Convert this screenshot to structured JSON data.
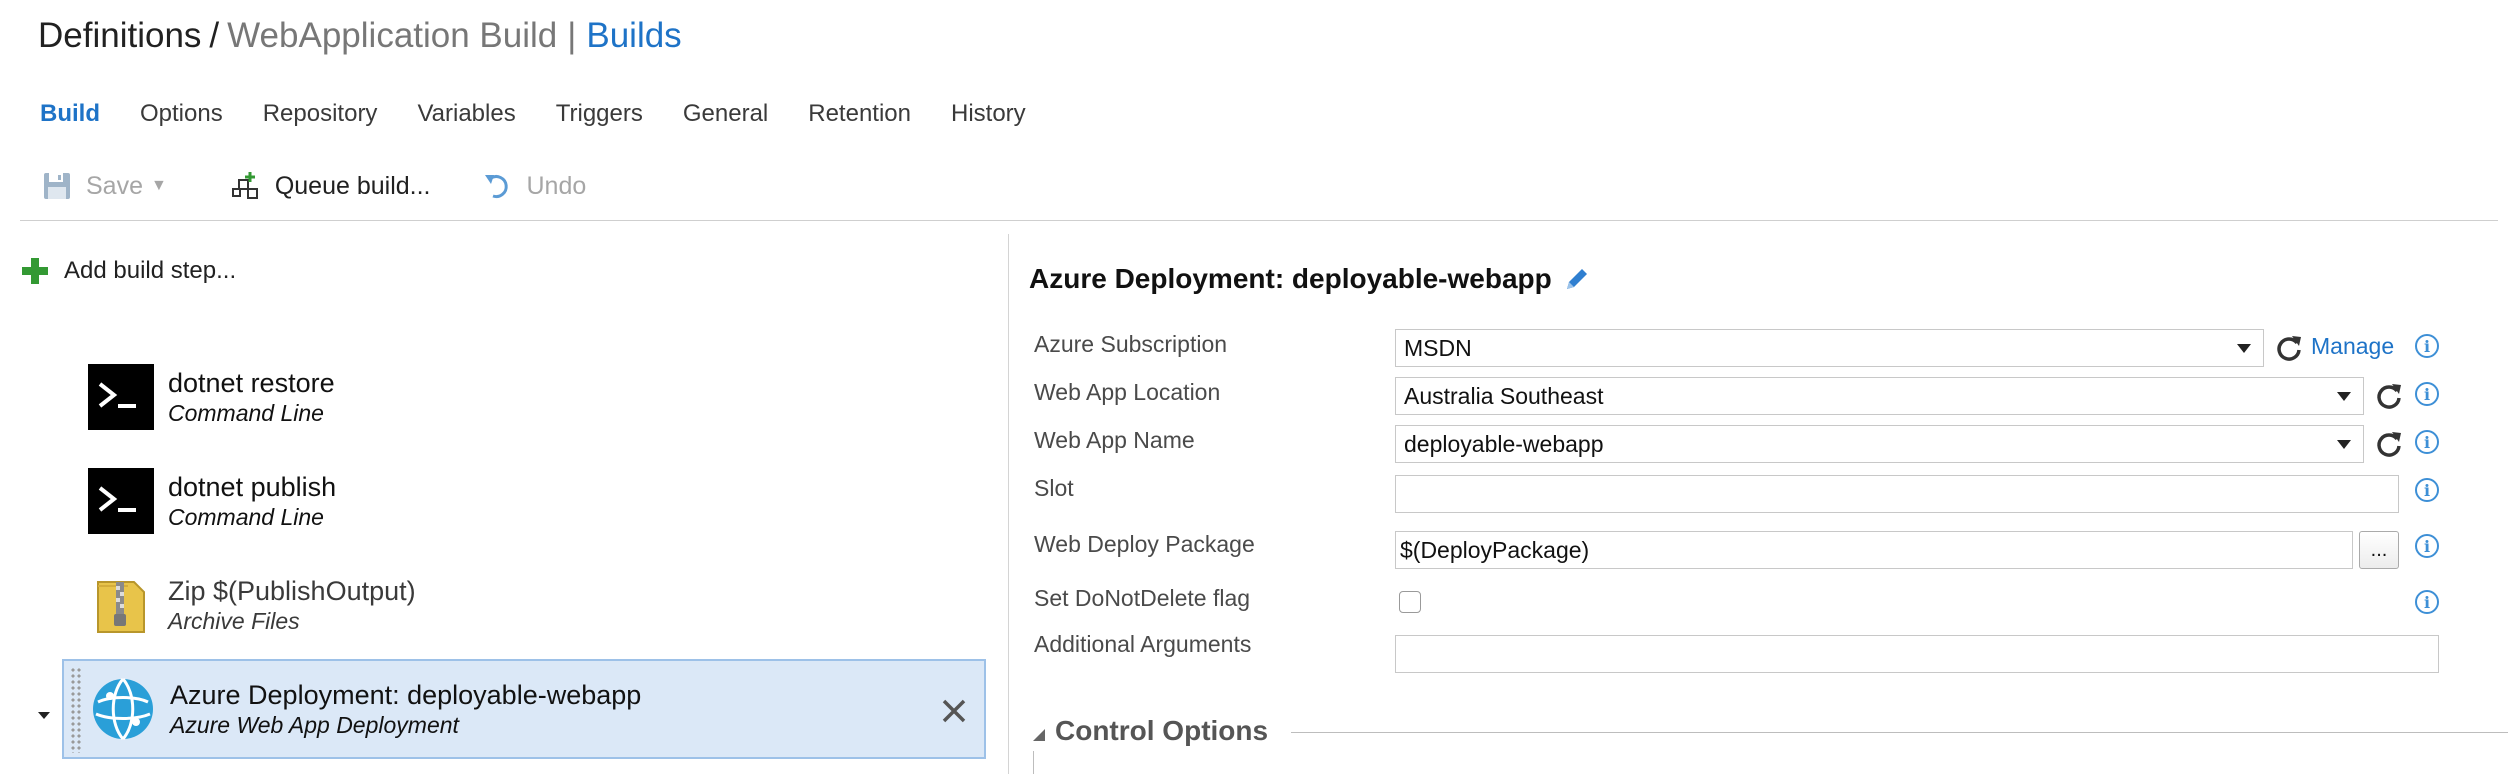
{
  "breadcrumb": {
    "root": "Definitions",
    "separator": "/",
    "definition_name": "WebApplication Build",
    "pipe": "|",
    "section": "Builds"
  },
  "tabs": [
    {
      "label": "Build",
      "active": true
    },
    {
      "label": "Options"
    },
    {
      "label": "Repository"
    },
    {
      "label": "Variables"
    },
    {
      "label": "Triggers"
    },
    {
      "label": "General"
    },
    {
      "label": "Retention"
    },
    {
      "label": "History"
    }
  ],
  "toolbar": {
    "save_label": "Save",
    "queue_label": "Queue build...",
    "undo_label": "Undo"
  },
  "left_panel": {
    "add_step_label": "Add build step...",
    "steps": [
      {
        "name": "dotnet restore",
        "type": "Command Line",
        "icon": "command-line-icon"
      },
      {
        "name": "dotnet publish",
        "type": "Command Line",
        "icon": "command-line-icon"
      },
      {
        "name": "Zip $(PublishOutput)",
        "type": "Archive Files",
        "icon": "zip-archive-icon"
      },
      {
        "name": "Azure Deployment: deployable-webapp",
        "type": "Azure Web App Deployment",
        "icon": "azure-web-app-icon",
        "selected": true
      }
    ]
  },
  "task": {
    "title": "Azure Deployment: deployable-webapp",
    "fields": {
      "subscription": {
        "label": "Azure Subscription",
        "value": "MSDN",
        "manage_label": "Manage"
      },
      "location": {
        "label": "Web App Location",
        "value": "Australia Southeast"
      },
      "app_name": {
        "label": "Web App Name",
        "value": "deployable-webapp"
      },
      "slot": {
        "label": "Slot",
        "value": ""
      },
      "package": {
        "label": "Web Deploy Package",
        "value": "$(DeployPackage)",
        "browse_label": "..."
      },
      "do_not_delete": {
        "label": "Set DoNotDelete flag",
        "checked": false
      },
      "additional_args": {
        "label": "Additional Arguments",
        "value": ""
      }
    },
    "info_glyph": "i",
    "control_options_label": "Control Options"
  },
  "colors": {
    "accent": "#1e73c7",
    "selected_bg": "#dbe8f7",
    "add_green": "#339933",
    "azure_blue": "#2a9fd8",
    "zip_yellow": "#e8c44a"
  }
}
